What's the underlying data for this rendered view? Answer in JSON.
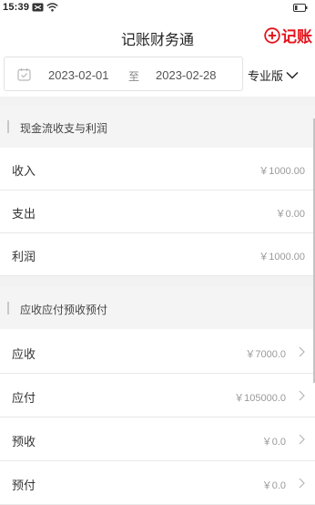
{
  "status_bar": {
    "time": "15:39",
    "icons": [
      "message-icon",
      "wifi-icon",
      "battery-icon"
    ]
  },
  "header": {
    "title": "记账财务通",
    "record_label": "记账",
    "accent_color": "#e4141c"
  },
  "date_filter": {
    "start": "2023-02-01",
    "separator": "至",
    "end": "2023-02-28",
    "version": "专业版"
  },
  "cashflow_section": {
    "title": "现金流收支与利润",
    "rows": [
      {
        "label": "收入",
        "value": "￥1000.00"
      },
      {
        "label": "支出",
        "value": "￥0.00"
      },
      {
        "label": "利润",
        "value": "￥1000.00"
      }
    ]
  },
  "receivables_section": {
    "title": "应收应付预收预付",
    "rows": [
      {
        "label": "应收",
        "value": "￥7000.0"
      },
      {
        "label": "应付",
        "value": "￥105000.0"
      },
      {
        "label": "预收",
        "value": "￥0.0"
      },
      {
        "label": "预付",
        "value": "￥0.0"
      }
    ]
  }
}
